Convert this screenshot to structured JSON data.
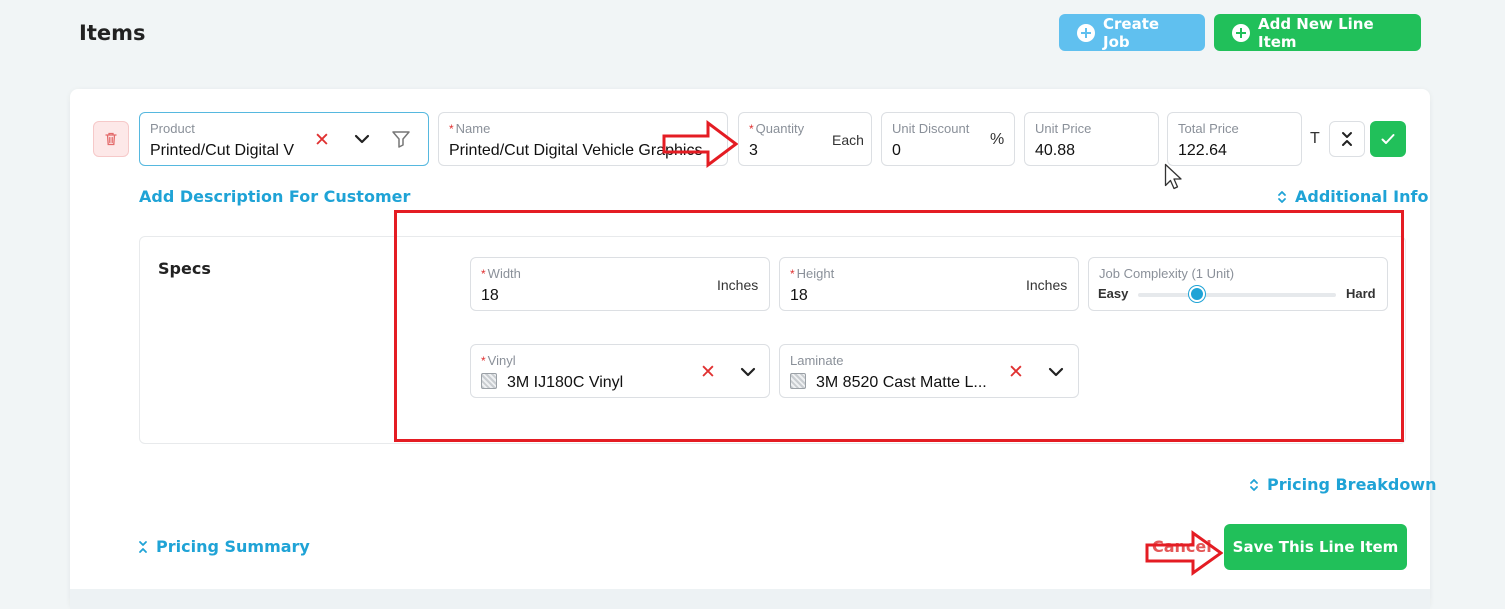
{
  "header": {
    "title": "Items",
    "create_job_label": "Create Job",
    "add_line_item_label": "Add New Line Item"
  },
  "line_item": {
    "product": {
      "label": "Product",
      "value": "Printed/Cut Digital V"
    },
    "name": {
      "label": "Name",
      "value": "Printed/Cut Digital Vehicle Graphics"
    },
    "quantity": {
      "label": "Quantity",
      "value": "3",
      "unit": "Each"
    },
    "unit_discount": {
      "label": "Unit Discount",
      "value": "0",
      "unit": "%"
    },
    "unit_price": {
      "label": "Unit Price",
      "value": "40.88"
    },
    "total_price": {
      "label": "Total Price",
      "value": "122.64"
    },
    "t_label": "T",
    "add_description_link": "Add Description For Customer",
    "additional_info_link": "Additional Info"
  },
  "specs": {
    "title": "Specs",
    "width": {
      "label": "Width",
      "value": "18",
      "unit": "Inches"
    },
    "height": {
      "label": "Height",
      "value": "18",
      "unit": "Inches"
    },
    "complexity": {
      "label": "Job Complexity (1 Unit)",
      "min_label": "Easy",
      "max_label": "Hard",
      "level": 0.3
    },
    "vinyl": {
      "label": "Vinyl",
      "value": "3M IJ180C Vinyl"
    },
    "laminate": {
      "label": "Laminate",
      "value": "3M 8520 Cast Matte L..."
    }
  },
  "footer": {
    "pricing_breakdown_link": "Pricing Breakdown",
    "pricing_summary_link": "Pricing Summary",
    "cancel_label": "Cancel",
    "save_label": "Save This Line Item"
  },
  "colors": {
    "accent_blue": "#1fa3d6",
    "success_green": "#21c05a",
    "annotation_red": "#e41c23"
  }
}
